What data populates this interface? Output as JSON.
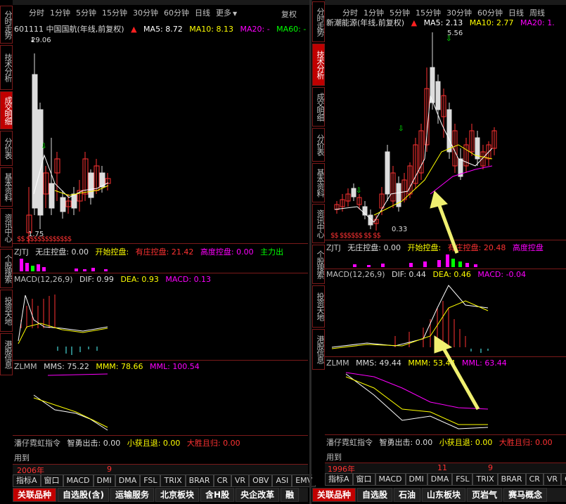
{
  "top_strip": {
    "left_labels": [
      "自选股",
      "分类股",
      "显示器"
    ]
  },
  "left": {
    "periods": [
      "分时",
      "1分钟",
      "5分钟",
      "15分钟",
      "30分钟",
      "60分钟",
      "日线",
      "更多"
    ],
    "period_more_arrow": "▼",
    "restore": "复权",
    "title": "601111 中国国航(年线,前复权)",
    "ma5": "MA5: 8.72",
    "ma10": "MA10: 8.13",
    "ma20": "MA20: -",
    "ma60": "MA60: -",
    "price_high": "29.06",
    "price_low": "1.75",
    "dollar_marks": "$$ $$$$$$$$$$$$",
    "zjtj": {
      "name": "ZJTJ",
      "wzkp": "无庄控盘: 0.00",
      "kskp": "开始控盘:",
      "ykp": "有庄控盘: 21.42",
      "gdkp": "高度控盘: 0.00",
      "zl": "主力出"
    },
    "macd": {
      "name": "MACD(12,26,9)",
      "dif": "DIF: 0.99",
      "dea": "DEA: 0.93",
      "macd": "MACD: 0.13"
    },
    "zlmm": {
      "name": "ZLMM",
      "mms": "MMS: 75.22",
      "mmm": "MMM: 78.66",
      "mml": "MML: 100.54"
    },
    "pzhn": {
      "name": "潘仔霓虹指令",
      "zy": "智勇出击: 0.00",
      "xh": "小获且退: 0.00",
      "ds": "大胜且归: 0.00"
    },
    "foot_text": "用到",
    "year_label": "2006年",
    "year_end": "9",
    "ind_tabs": [
      "指标A",
      "窗口",
      "MACD",
      "DMI",
      "DMA",
      "FSL",
      "TRIX",
      "BRAR",
      "CR",
      "VR",
      "OBV",
      "ASI",
      "EMV"
    ],
    "sectors": [
      "关联品种",
      "自选股(含)",
      "运输服务",
      "北京板块",
      "含H股",
      "央企改革",
      "融"
    ],
    "side": [
      "分时走势",
      "技术分析",
      "成交明细",
      "分价表",
      "基本资料",
      "资讯中心",
      "个股搜索",
      "投资天地",
      "港股信息"
    ]
  },
  "right": {
    "periods": [
      "分时",
      "1分钟",
      "5分钟",
      "15分钟",
      "30分钟",
      "60分钟",
      "日线",
      "周线"
    ],
    "title": "新潮能源(年线,前复权)",
    "ma5": "MA5: 2.13",
    "ma10": "MA10: 2.77",
    "ma20": "MA20: 1.",
    "price_high": "5.56",
    "price_low": "0.33",
    "dollar_marks": "$$ $$$$$$ $$ $$",
    "zjtj": {
      "name": "ZJTJ",
      "wzkp": "无庄控盘: 0.00",
      "kskp": "开始控盘:",
      "ykp": "有庄控盘: 20.48",
      "gdkp": "高度控盘"
    },
    "macd": {
      "name": "MACD(12,26,9)",
      "dif": "DIF: 0.44",
      "dea": "DEA: 0.46",
      "macd": "MACD: -0.04"
    },
    "zlmm": {
      "name": "ZLMM",
      "mms": "MMS: 49.44",
      "mmm": "MMM: 53.44",
      "mml": "MML: 63.44"
    },
    "pzhn": {
      "name": "潘仔霓虹指令",
      "zy": "智勇出击: 0.00",
      "xh": "小获且退: 0.00",
      "ds": "大胜且归: 0.00"
    },
    "foot_text": "用到",
    "year_label": "1996年",
    "year_mid": "11",
    "year_end": "9",
    "ind_tabs": [
      "指标A",
      "窗口",
      "MACD",
      "DMI",
      "DMA",
      "FSL",
      "TRIX",
      "BRAR",
      "CR",
      "VR",
      "OBV"
    ],
    "sectors": [
      "关联品种",
      "自选股",
      "石油",
      "山东板块",
      "页岩气",
      "赛马概念"
    ],
    "side": [
      "分时走势",
      "技术分析",
      "成交明细",
      "分价表",
      "基本资料",
      "资讯中心",
      "个股搜索",
      "投资天地",
      "港股信息"
    ]
  },
  "colors": {
    "up": "#ff3232",
    "down": "#54ffff",
    "ma5": "#ffffff",
    "ma10": "#ffff00",
    "ma20": "#ff00ff",
    "ma60": "#00ff00",
    "grid": "#7a1a1a",
    "arrow": "#f0f070"
  }
}
